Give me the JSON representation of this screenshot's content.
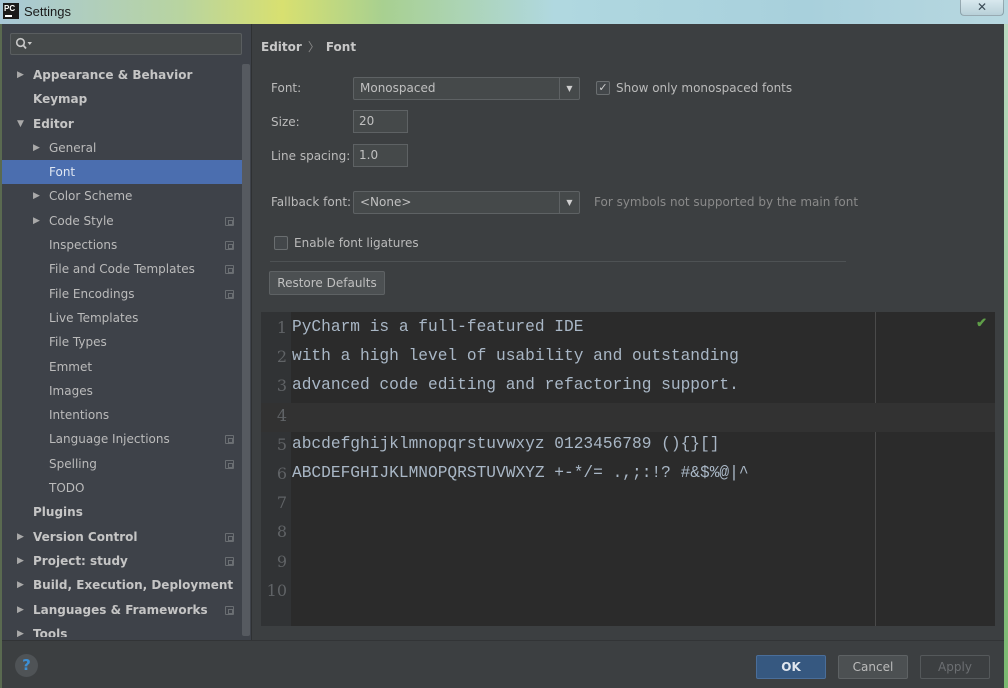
{
  "window": {
    "app_icon_text": "PC",
    "title": "Settings",
    "close_symbol": "✕"
  },
  "search": {
    "placeholder": "",
    "value": "",
    "icon": "search-icon"
  },
  "sidebar": {
    "items": [
      {
        "label": "Appearance & Behavior",
        "level": 0,
        "bold": true,
        "arrow": "▶",
        "project_icon": false,
        "selected": false
      },
      {
        "label": "Keymap",
        "level": 0,
        "bold": true,
        "arrow": "",
        "project_icon": false,
        "selected": false
      },
      {
        "label": "Editor",
        "level": 0,
        "bold": true,
        "arrow": "▼",
        "project_icon": false,
        "selected": false
      },
      {
        "label": "General",
        "level": 1,
        "bold": false,
        "arrow": "▶",
        "project_icon": false,
        "selected": false
      },
      {
        "label": "Font",
        "level": 1,
        "bold": false,
        "arrow": "",
        "project_icon": false,
        "selected": true
      },
      {
        "label": "Color Scheme",
        "level": 1,
        "bold": false,
        "arrow": "▶",
        "project_icon": false,
        "selected": false
      },
      {
        "label": "Code Style",
        "level": 1,
        "bold": false,
        "arrow": "▶",
        "project_icon": true,
        "selected": false
      },
      {
        "label": "Inspections",
        "level": 1,
        "bold": false,
        "arrow": "",
        "project_icon": true,
        "selected": false
      },
      {
        "label": "File and Code Templates",
        "level": 1,
        "bold": false,
        "arrow": "",
        "project_icon": true,
        "selected": false
      },
      {
        "label": "File Encodings",
        "level": 1,
        "bold": false,
        "arrow": "",
        "project_icon": true,
        "selected": false
      },
      {
        "label": "Live Templates",
        "level": 1,
        "bold": false,
        "arrow": "",
        "project_icon": false,
        "selected": false
      },
      {
        "label": "File Types",
        "level": 1,
        "bold": false,
        "arrow": "",
        "project_icon": false,
        "selected": false
      },
      {
        "label": "Emmet",
        "level": 1,
        "bold": false,
        "arrow": "",
        "project_icon": false,
        "selected": false
      },
      {
        "label": "Images",
        "level": 1,
        "bold": false,
        "arrow": "",
        "project_icon": false,
        "selected": false
      },
      {
        "label": "Intentions",
        "level": 1,
        "bold": false,
        "arrow": "",
        "project_icon": false,
        "selected": false
      },
      {
        "label": "Language Injections",
        "level": 1,
        "bold": false,
        "arrow": "",
        "project_icon": true,
        "selected": false
      },
      {
        "label": "Spelling",
        "level": 1,
        "bold": false,
        "arrow": "",
        "project_icon": true,
        "selected": false
      },
      {
        "label": "TODO",
        "level": 1,
        "bold": false,
        "arrow": "",
        "project_icon": false,
        "selected": false
      },
      {
        "label": "Plugins",
        "level": 0,
        "bold": true,
        "arrow": "",
        "project_icon": false,
        "selected": false
      },
      {
        "label": "Version Control",
        "level": 0,
        "bold": true,
        "arrow": "▶",
        "project_icon": true,
        "selected": false
      },
      {
        "label": "Project: study",
        "level": 0,
        "bold": true,
        "arrow": "▶",
        "project_icon": true,
        "selected": false
      },
      {
        "label": "Build, Execution, Deployment",
        "level": 0,
        "bold": true,
        "arrow": "▶",
        "project_icon": false,
        "selected": false
      },
      {
        "label": "Languages & Frameworks",
        "level": 0,
        "bold": true,
        "arrow": "▶",
        "project_icon": true,
        "selected": false
      },
      {
        "label": "Tools",
        "level": 0,
        "bold": true,
        "arrow": "▶",
        "project_icon": false,
        "selected": false
      }
    ]
  },
  "breadcrumb": {
    "parent": "Editor",
    "separator": "〉",
    "current": "Font"
  },
  "form": {
    "font_label": "Font:",
    "font_value": "Monospaced",
    "show_mono_label": "Show only monospaced fonts",
    "show_mono_checked": true,
    "size_label": "Size:",
    "size_value": "20",
    "line_spacing_label": "Line spacing:",
    "line_spacing_value": "1.0",
    "fallback_label": "Fallback font:",
    "fallback_value": "<None>",
    "fallback_hint": "For symbols not supported by the main font",
    "ligatures_label": "Enable font ligatures",
    "ligatures_checked": false,
    "restore_defaults_label": "Restore Defaults",
    "dropdown_arrow": "▼",
    "check_mark": "✓"
  },
  "preview": {
    "lines": [
      {
        "num": "1",
        "text": "PyCharm is a full-featured IDE"
      },
      {
        "num": "2",
        "text": "with a high level of usability and outstanding"
      },
      {
        "num": "3",
        "text": "advanced code editing and refactoring support."
      },
      {
        "num": "4",
        "text": ""
      },
      {
        "num": "5",
        "text": "abcdefghijklmnopqrstuvwxyz 0123456789 (){}[]"
      },
      {
        "num": "6",
        "text": "ABCDEFGHIJKLMNOPQRSTUVWXYZ +-*/= .,;:!? #&$%@|^"
      },
      {
        "num": "7",
        "text": ""
      },
      {
        "num": "8",
        "text": ""
      },
      {
        "num": "9",
        "text": ""
      },
      {
        "num": "10",
        "text": ""
      }
    ],
    "current_line": 4,
    "status_icon": "✔"
  },
  "footer": {
    "help_label": "?",
    "ok_label": "OK",
    "cancel_label": "Cancel",
    "apply_label": "Apply"
  },
  "colors": {
    "selection": "#4b6eaf",
    "ok_button": "#365880",
    "editor_bg": "#2b2b2b",
    "inspection_ok": "#5f9e48"
  }
}
